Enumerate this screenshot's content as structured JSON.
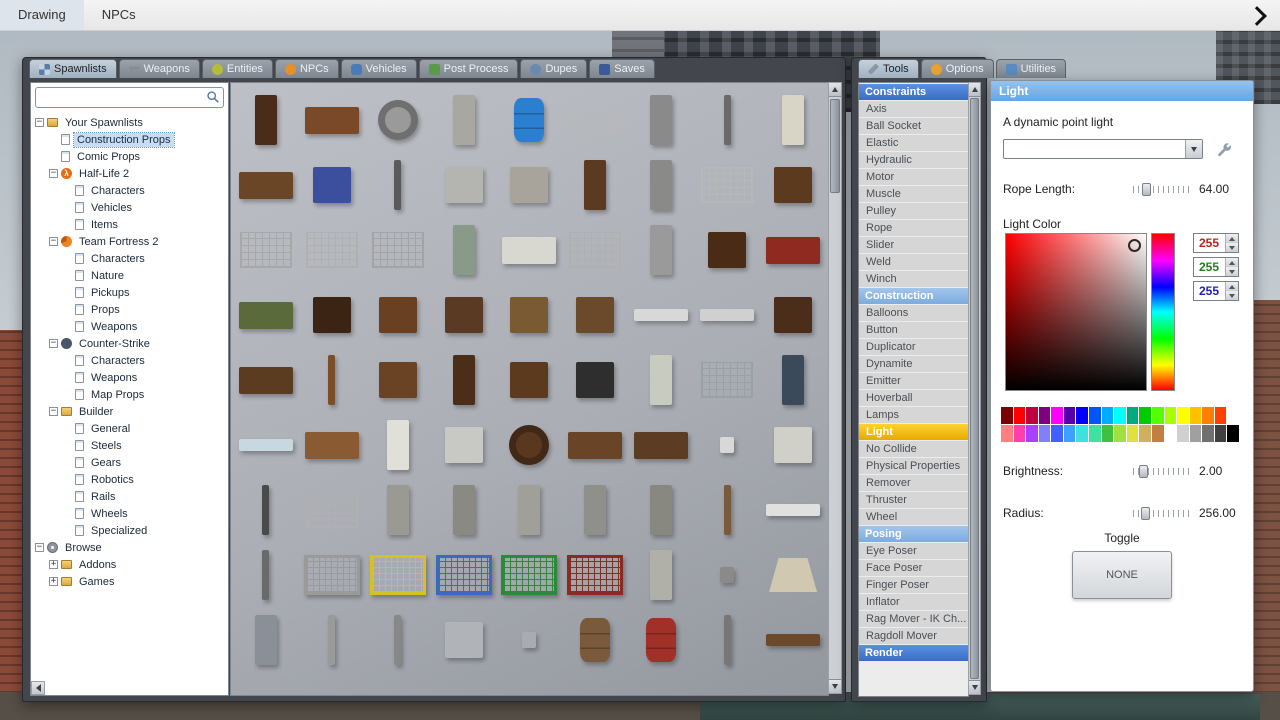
{
  "menubar": {
    "items": [
      "Drawing",
      "NPCs"
    ]
  },
  "spawn_panel": {
    "tabs": [
      {
        "label": "Spawnlists",
        "icon": "spawnlists-icon",
        "active": true
      },
      {
        "label": "Weapons",
        "icon": "weapons-icon"
      },
      {
        "label": "Entities",
        "icon": "entities-icon"
      },
      {
        "label": "NPCs",
        "icon": "npcs-icon"
      },
      {
        "label": "Vehicles",
        "icon": "vehicles-icon"
      },
      {
        "label": "Post Process",
        "icon": "postprocess-icon"
      },
      {
        "label": "Dupes",
        "icon": "dupes-icon"
      },
      {
        "label": "Saves",
        "icon": "saves-icon"
      }
    ],
    "search": {
      "value": "",
      "placeholder": ""
    },
    "tree": [
      {
        "label": "Your Spawnlists",
        "level": 0,
        "icon": "folder",
        "exp": "minus"
      },
      {
        "label": "Construction Props",
        "level": 1,
        "icon": "page",
        "selected": true
      },
      {
        "label": "Comic Props",
        "level": 1,
        "icon": "page"
      },
      {
        "label": "Half-Life 2",
        "level": 1,
        "icon": "hl2",
        "exp": "minus"
      },
      {
        "label": "Characters",
        "level": 2,
        "icon": "page"
      },
      {
        "label": "Vehicles",
        "level": 2,
        "icon": "page"
      },
      {
        "label": "Items",
        "level": 2,
        "icon": "page"
      },
      {
        "label": "Team Fortress 2",
        "level": 1,
        "icon": "tf2",
        "exp": "minus"
      },
      {
        "label": "Characters",
        "level": 2,
        "icon": "page"
      },
      {
        "label": "Nature",
        "level": 2,
        "icon": "page"
      },
      {
        "label": "Pickups",
        "level": 2,
        "icon": "page"
      },
      {
        "label": "Props",
        "level": 2,
        "icon": "page"
      },
      {
        "label": "Weapons",
        "level": 2,
        "icon": "page"
      },
      {
        "label": "Counter-Strike",
        "level": 1,
        "icon": "cs",
        "exp": "minus"
      },
      {
        "label": "Characters",
        "level": 2,
        "icon": "page"
      },
      {
        "label": "Weapons",
        "level": 2,
        "icon": "page"
      },
      {
        "label": "Map Props",
        "level": 2,
        "icon": "page"
      },
      {
        "label": "Builder",
        "level": 1,
        "icon": "folder",
        "exp": "minus"
      },
      {
        "label": "General",
        "level": 2,
        "icon": "page"
      },
      {
        "label": "Steels",
        "level": 2,
        "icon": "page"
      },
      {
        "label": "Gears",
        "level": 2,
        "icon": "page"
      },
      {
        "label": "Robotics",
        "level": 2,
        "icon": "page"
      },
      {
        "label": "Rails",
        "level": 2,
        "icon": "page"
      },
      {
        "label": "Wheels",
        "level": 2,
        "icon": "page"
      },
      {
        "label": "Specialized",
        "level": 2,
        "icon": "page"
      },
      {
        "label": "Browse",
        "level": 0,
        "icon": "gear",
        "exp": "minus"
      },
      {
        "label": "Addons",
        "level": 1,
        "icon": "folder",
        "exp": "plus"
      },
      {
        "label": "Games",
        "level": 1,
        "icon": "folder",
        "exp": "plus"
      }
    ],
    "props": [
      {
        "n": "barstool",
        "c": "#4a2d18",
        "s": "tall"
      },
      {
        "n": "shelf-with-cans",
        "c": "#7a4a28",
        "s": "wide"
      },
      {
        "n": "wheel",
        "c": "#9a9a9a",
        "s": "circle"
      },
      {
        "n": "metal-door",
        "c": "#a8a8a0",
        "s": "tall"
      },
      {
        "n": "blue-barrel",
        "c": "#2a7fd0",
        "s": "barrel"
      },
      {
        "n": "jail-window",
        "c": "#b8b8b8",
        "s": "grid"
      },
      {
        "n": "canister",
        "c": "#8a8a8a",
        "s": "tall"
      },
      {
        "n": "pipe",
        "c": "#6a6a6a",
        "s": "thin"
      },
      {
        "n": "propane-tank",
        "c": "#d8d4c6",
        "s": "tall"
      },
      {
        "n": "wooden-bench",
        "c": "#6a4526",
        "s": "wide"
      },
      {
        "n": "blue-chair",
        "c": "#3c4e9e",
        "s": "rect"
      },
      {
        "n": "lamp-pole",
        "c": "#5a5a5a",
        "s": "thin"
      },
      {
        "n": "barrier",
        "c": "#b4b4b0",
        "s": "rect"
      },
      {
        "n": "metal-shelf",
        "c": "#a8a49c",
        "s": "rect"
      },
      {
        "n": "dark-door",
        "c": "#5a3a20",
        "s": "tall"
      },
      {
        "n": "mirror-door",
        "c": "#8a8a88",
        "s": "tall"
      },
      {
        "n": "bed-frame",
        "c": "#b8b8b8",
        "s": "grid"
      },
      {
        "n": "wood-chair",
        "c": "#5c3a1e",
        "s": "rect"
      },
      {
        "n": "metal-gate",
        "c": "#a8a8a8",
        "s": "grid"
      },
      {
        "n": "wire-fence",
        "c": "#b0b0b0",
        "s": "grid"
      },
      {
        "n": "wire-fence-2",
        "c": "#a4a4a4",
        "s": "grid"
      },
      {
        "n": "fountain",
        "c": "#8a9a8a",
        "s": "tall"
      },
      {
        "n": "bathtub",
        "c": "#d8d8d0",
        "s": "wide"
      },
      {
        "n": "bunk-frame",
        "c": "#b0b0b0",
        "s": "grid"
      },
      {
        "n": "trash-bin",
        "c": "#9a9a9a",
        "s": "tall"
      },
      {
        "n": "wood-chair-2",
        "c": "#4a2c16",
        "s": "rect"
      },
      {
        "n": "red-couch",
        "c": "#8e2a20",
        "s": "wide"
      },
      {
        "n": "green-couch",
        "c": "#5a6a3a",
        "s": "wide"
      },
      {
        "n": "dark-dresser",
        "c": "#3c2414",
        "s": "rect"
      },
      {
        "n": "wood-dresser",
        "c": "#6a4022",
        "s": "rect"
      },
      {
        "n": "wood-box",
        "c": "#5a3a22",
        "s": "rect"
      },
      {
        "n": "wood-crate",
        "c": "#7a5a32",
        "s": "rect"
      },
      {
        "n": "wood-crate-2",
        "c": "#6a4a2a",
        "s": "rect"
      },
      {
        "n": "mattress",
        "c": "#d8d8d8",
        "s": "flat"
      },
      {
        "n": "mattress-2",
        "c": "#d0d0d0",
        "s": "flat"
      },
      {
        "n": "dresser-2",
        "c": "#4a2e1a",
        "s": "rect"
      },
      {
        "n": "low-table",
        "c": "#5c3c20",
        "s": "wide"
      },
      {
        "n": "canoe",
        "c": "#7a4e28",
        "s": "thin"
      },
      {
        "n": "desk",
        "c": "#6a4224",
        "s": "rect"
      },
      {
        "n": "wood-cabinet",
        "c": "#4a2e18",
        "s": "tall"
      },
      {
        "n": "nightstand",
        "c": "#5c3a1e",
        "s": "rect"
      },
      {
        "n": "stove",
        "c": "#2e2e2e",
        "s": "rect"
      },
      {
        "n": "fridge",
        "c": "#c8ccc0",
        "s": "tall"
      },
      {
        "n": "radiator",
        "c": "#98a0a8",
        "s": "grid"
      },
      {
        "n": "vending-machine",
        "c": "#3a4a5a",
        "s": "tall"
      },
      {
        "n": "glass-pane",
        "c": "#c8d8e0",
        "s": "flat"
      },
      {
        "n": "bench-frame",
        "c": "#8a5a32",
        "s": "wide"
      },
      {
        "n": "sink",
        "c": "#e0e0d8",
        "s": "tall"
      },
      {
        "n": "metal-cabinet",
        "c": "#c8c8c4",
        "s": "rect"
      },
      {
        "n": "round-table",
        "c": "#5a3820",
        "s": "circle"
      },
      {
        "n": "wood-table",
        "c": "#6a4426",
        "s": "wide"
      },
      {
        "n": "wood-table-2",
        "c": "#5c3c22",
        "s": "wide"
      },
      {
        "n": "paper-scrap",
        "c": "#d8d8d8",
        "s": "tiny"
      },
      {
        "n": "washing-machine",
        "c": "#d0d0c8",
        "s": "rect"
      },
      {
        "n": "street-lamp",
        "c": "#4a4a4a",
        "s": "thin"
      },
      {
        "n": "yard-gate",
        "c": "#b0b0b0",
        "s": "grid"
      },
      {
        "n": "tombstone",
        "c": "#9a9a92",
        "s": "tall"
      },
      {
        "n": "tombstone-2",
        "c": "#8a8a82",
        "s": "tall"
      },
      {
        "n": "tombstone-3",
        "c": "#a0a098",
        "s": "tall"
      },
      {
        "n": "tombstone-4",
        "c": "#90908a",
        "s": "tall"
      },
      {
        "n": "tombstone-5",
        "c": "#888880",
        "s": "tall"
      },
      {
        "n": "wood-cross",
        "c": "#7a5a3a",
        "s": "thin"
      },
      {
        "n": "white-panel",
        "c": "#e0e0e0",
        "s": "flat"
      },
      {
        "n": "hydrant-pole",
        "c": "#6a6a6a",
        "s": "thin"
      },
      {
        "n": "cage-gray",
        "c": "#9a9a9a",
        "s": "cage"
      },
      {
        "n": "cage-yellow",
        "c": "#d8c020",
        "s": "cage"
      },
      {
        "n": "cage-blue",
        "c": "#3a6ac0",
        "s": "cage"
      },
      {
        "n": "cage-green",
        "c": "#2a8a3a",
        "s": "cage"
      },
      {
        "n": "cage-red",
        "c": "#8a2a22",
        "s": "cage"
      },
      {
        "n": "concrete-pillar",
        "c": "#b0b0a8",
        "s": "tall"
      },
      {
        "n": "small-trophy",
        "c": "#8a8a8a",
        "s": "tiny"
      },
      {
        "n": "lampshade",
        "c": "#d0c8b0",
        "s": "cone"
      },
      {
        "n": "lockers",
        "c": "#8a9098",
        "s": "tall"
      },
      {
        "n": "ladder",
        "c": "#9a9a9a",
        "s": "thin"
      },
      {
        "n": "scaffold-pole",
        "c": "#888888",
        "s": "thin"
      },
      {
        "n": "u-pipe",
        "c": "#b0b4b8",
        "s": "rect"
      },
      {
        "n": "faucet",
        "c": "#a8acb0",
        "s": "tiny"
      },
      {
        "n": "oil-drum",
        "c": "#7a5a3a",
        "s": "barrel"
      },
      {
        "n": "red-barrel",
        "c": "#a03028",
        "s": "barrel"
      },
      {
        "n": "metal-rod",
        "c": "#777777",
        "s": "thin"
      },
      {
        "n": "wood-pallet",
        "c": "#6a4a2a",
        "s": "flat"
      }
    ]
  },
  "tool_panel": {
    "tabs": [
      {
        "label": "Tools",
        "icon": "wrench-icon",
        "active": true
      },
      {
        "label": "Options",
        "icon": "options-icon"
      },
      {
        "label": "Utilities",
        "icon": "utilities-icon"
      }
    ],
    "categories": [
      {
        "name": "Constraints",
        "style": "dark",
        "items": [
          "Axis",
          "Ball Socket",
          "Elastic",
          "Hydraulic",
          "Motor",
          "Muscle",
          "Pulley",
          "Rope",
          "Slider",
          "Weld",
          "Winch"
        ]
      },
      {
        "name": "Construction",
        "style": "light",
        "selected": "Light",
        "items": [
          "Balloons",
          "Button",
          "Duplicator",
          "Dynamite",
          "Emitter",
          "Hoverball",
          "Lamps",
          "Light",
          "No Collide",
          "Physical Properties",
          "Remover",
          "Thruster",
          "Wheel"
        ]
      },
      {
        "name": "Posing",
        "style": "light",
        "items": [
          "Eye Poser",
          "Face Poser",
          "Finger Poser",
          "Inflator",
          "Rag Mover - IK Ch...",
          "Ragdoll Mover"
        ]
      },
      {
        "name": "Render",
        "style": "dark",
        "items": []
      }
    ]
  },
  "light_panel": {
    "title": "Light",
    "description": "A dynamic point light",
    "preset_value": "",
    "rope_length": {
      "label": "Rope Length:",
      "value": "64.00"
    },
    "light_color_label": "Light Color",
    "rgb": [
      {
        "value": "255",
        "color": "#c02020"
      },
      {
        "value": "255",
        "color": "#208020"
      },
      {
        "value": "255",
        "color": "#2020c0"
      }
    ],
    "palette": [
      [
        "#7f0000",
        "#ff0000",
        "#bf0040",
        "#7f007f",
        "#ff00ff",
        "#5500aa",
        "#0000ff",
        "#0055ff",
        "#00aaff",
        "#00ffff",
        "#00aa7f",
        "#00cc00",
        "#55ff00",
        "#aaff00",
        "#ffff00",
        "#ffc000",
        "#ff8000",
        "#ff4000",
        "#ffffff"
      ],
      [
        "#ff8080",
        "#ff40aa",
        "#aa40ff",
        "#8080ff",
        "#4060ff",
        "#40a0ff",
        "#40e0e0",
        "#40e0a0",
        "#40c040",
        "#a0e040",
        "#e0e040",
        "#d0b060",
        "#c08040",
        "#ffffff",
        "#d0d0d0",
        "#a0a0a0",
        "#707070",
        "#404040",
        "#000000"
      ]
    ],
    "brightness": {
      "label": "Brightness:",
      "value": "2.00"
    },
    "radius": {
      "label": "Radius:",
      "value": "256.00"
    },
    "toggle_label": "Toggle",
    "toggle_button": "NONE"
  }
}
